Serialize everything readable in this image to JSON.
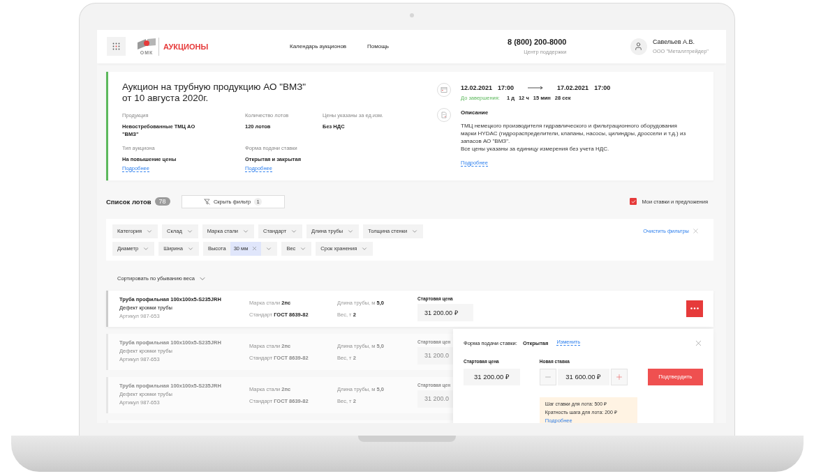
{
  "header": {
    "brand": "ОМК",
    "title": "АУКЦИОНЫ",
    "nav": [
      "Календарь аукционов",
      "Помощь"
    ],
    "phone": "8 (800) 200-8000",
    "phone_caption": "Центр поддержки",
    "user": {
      "name": "Савельев А.В.",
      "company": "ООО \"Металлтрейдер\""
    }
  },
  "auction": {
    "title": "Аукцион на трубную продукцию АО \"ВМЗ\" от 10 августа 2020г.",
    "fields": [
      {
        "label": "Продукция",
        "value": "Невостребованные ТМЦ АО \"ВМЗ\""
      },
      {
        "label": "Количество лотов",
        "value": "120 лотов"
      },
      {
        "label": "Цены указаны за ед.изм.",
        "value": "Без НДС"
      },
      {
        "label": "Тип аукциона",
        "value": "На повышение цены",
        "link": "Подробнее"
      },
      {
        "label": "Форма подачи ставки",
        "value": "Открытая и закрытая",
        "link": "Подробнее"
      }
    ],
    "start": {
      "date": "12.02.2021",
      "time": "17:00"
    },
    "end": {
      "date": "17.02.2021",
      "time": "17:00"
    },
    "countdown_label": "До завершения:",
    "countdown": [
      "1 д",
      "12 ч",
      "15 мин",
      "28 сек"
    ],
    "description_title": "Описание",
    "description": [
      "ТМЦ немецкого производителя гидравлического и фильтрационного оборудования марки HYDAC (гидрораспределители, клапаны, насосы, цилиндры, дроссели и т.д.) из запасов АО \"ВМЗ\".",
      "Все цены указаны за единицу измерения без учета НДС."
    ],
    "more": "Подробнее"
  },
  "lots_header": {
    "title": "Список лотов",
    "count": "78",
    "filter_button": "Скрыть фильтр",
    "filter_count": "1",
    "my_bids": {
      "label": "Мои ставки и предложения",
      "checked": true
    }
  },
  "filter_rows": [
    [
      {
        "label": "Категория"
      },
      {
        "label": "Склад"
      },
      {
        "label": "Марка стали"
      },
      {
        "label": "Стандарт"
      },
      {
        "label": "Длина трубы"
      },
      {
        "label": "Толщина стенки"
      }
    ],
    [
      {
        "label": "Диаметр"
      },
      {
        "label": "Ширина"
      },
      {
        "label": "Высота",
        "value": "30 мм"
      },
      {
        "label": "Вес"
      },
      {
        "label": "Срок хранения"
      }
    ]
  ],
  "clear_filters": "Очистить фильтры",
  "sort": "Сортировать по убыванию веса",
  "lots": [
    {
      "name": "Труба профильная 100x100x5-S235JRH",
      "defect": "Дефект кромки трубы",
      "article": "Артикул 987-653",
      "steel_label": "Марка стали",
      "steel": "2пс",
      "standard_label": "Стандарт",
      "standard": "ГОСТ 8639-82",
      "length_label": "Длина трубы, м",
      "length": "5,0",
      "weight_label": "Вес, т",
      "weight": "2",
      "price_label": "Стартовая цена",
      "price": "31 200.00 ₽",
      "faded": false
    },
    {
      "name": "Труба профильная 100x100x5-S235JRH",
      "defect": "Дефект кромки трубы",
      "article": "Артикул 987-653",
      "steel_label": "Марка стали",
      "steel": "2пс",
      "standard_label": "Стандарт",
      "standard": "ГОСТ 8639-82",
      "length_label": "Длина трубы, м",
      "length": "5,0",
      "weight_label": "Вес, т",
      "weight": "2",
      "price_label": "Стартовая цен",
      "price": "31 200.0",
      "faded": true
    },
    {
      "name": "Труба профильная 100x100x5-S235JRH",
      "defect": "Дефект кромки трубы",
      "article": "Артикул 987-653",
      "steel_label": "Марка стали",
      "steel": "2пс",
      "standard_label": "Стандарт",
      "standard": "ГОСТ 8639-82",
      "length_label": "Длина трубы, м",
      "length": "5,0",
      "weight_label": "Вес, т",
      "weight": "2",
      "price_label": "Стартовая цен",
      "price": "31 200.0",
      "faded": true
    }
  ],
  "bid_panel": {
    "form_label": "Форма подачи ставки:",
    "form_value": "Открытая",
    "change_link": "Изменить",
    "start_label": "Стартовая цена",
    "start_price": "31 200.00 ₽",
    "new_label": "Новая ставка",
    "new_price": "31 600.00 ₽",
    "confirm": "Подтвердить",
    "info": [
      "Шаг ставки для лота: 500 ₽",
      "Кратность шага для лота: 200 ₽"
    ],
    "info_link": "Подробнее"
  }
}
